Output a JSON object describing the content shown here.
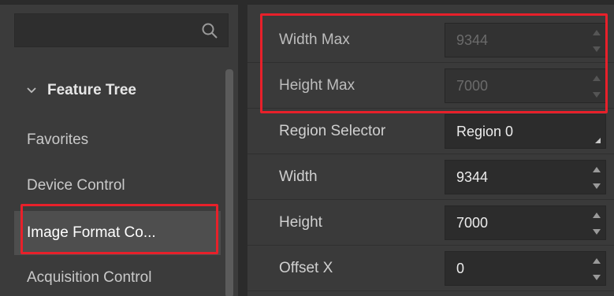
{
  "search": {
    "placeholder": "",
    "icon": "search-icon"
  },
  "tree": {
    "header": "Feature Tree",
    "items": [
      {
        "label": "Favorites",
        "selected": false
      },
      {
        "label": "Device Control",
        "selected": false
      },
      {
        "label": "Image Format Co...",
        "selected": true
      },
      {
        "label": "Acquisition Control",
        "selected": false
      }
    ]
  },
  "properties": [
    {
      "label": "Width Max",
      "value": "9344",
      "editor": "spin",
      "enabled": false
    },
    {
      "label": "Height Max",
      "value": "7000",
      "editor": "spin",
      "enabled": false
    },
    {
      "label": "Region Selector",
      "value": "Region 0",
      "editor": "combo",
      "enabled": true
    },
    {
      "label": "Width",
      "value": "9344",
      "editor": "spin",
      "enabled": true
    },
    {
      "label": "Height",
      "value": "7000",
      "editor": "spin",
      "enabled": true
    },
    {
      "label": "Offset X",
      "value": "0",
      "editor": "spin",
      "enabled": true
    }
  ],
  "colors": {
    "highlight": "#e8202a",
    "background": "#3a3a3a",
    "field": "#2c2c2c"
  }
}
